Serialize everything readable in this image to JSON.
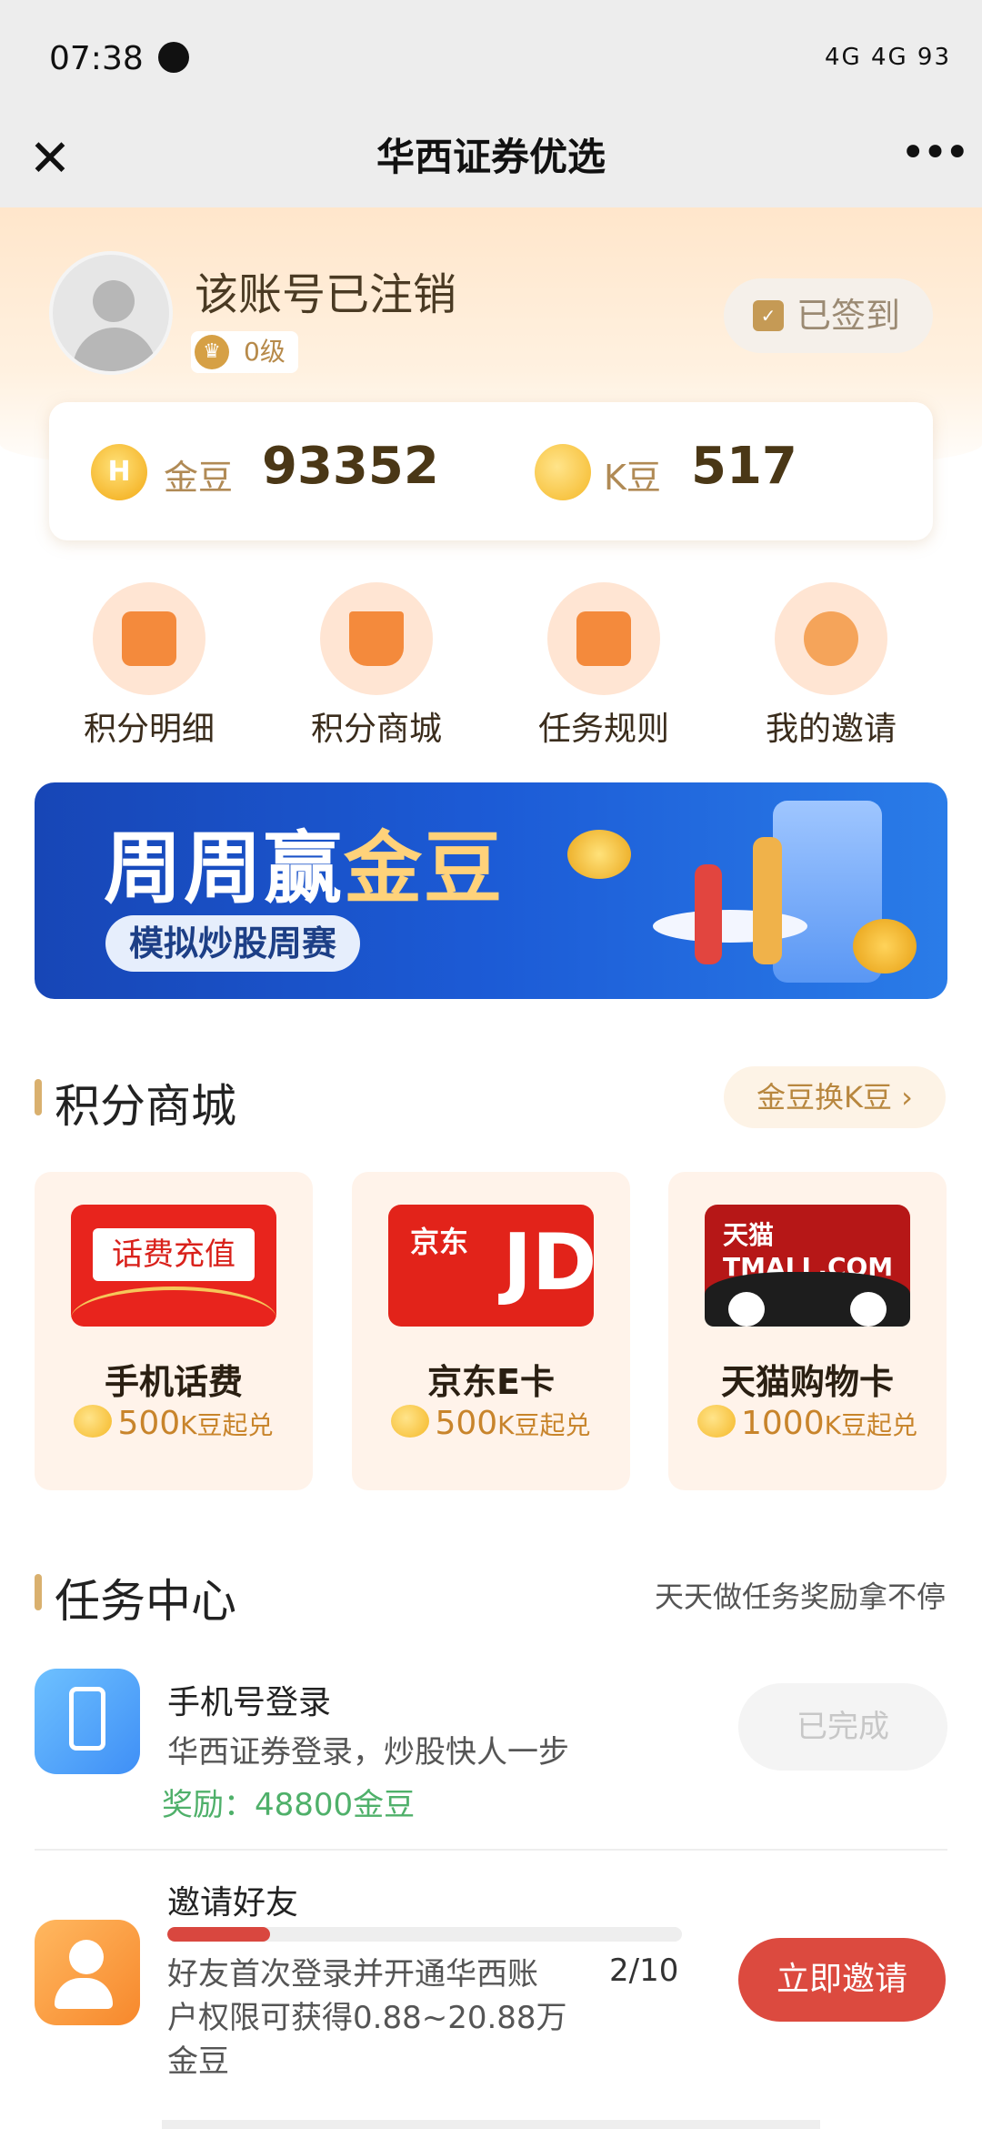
{
  "status_bar": {
    "time": "07:38",
    "indicators": "4G 4G 93"
  },
  "nav": {
    "close_icon": "close-icon",
    "title": "华西证券优选",
    "more_icon": "more-icon"
  },
  "profile": {
    "username": "该账号已注销",
    "level": "0级",
    "signin": "已签到"
  },
  "points": {
    "gold_label": "金豆",
    "gold_value": "93352",
    "k_label": "K豆",
    "k_value": "517"
  },
  "quick_actions": [
    {
      "label": "积分明细",
      "icon": "document-icon"
    },
    {
      "label": "积分商城",
      "icon": "cart-icon"
    },
    {
      "label": "任务规则",
      "icon": "rules-icon"
    },
    {
      "label": "我的邀请",
      "icon": "user-icon"
    }
  ],
  "banner": {
    "title_part1": "周周赢",
    "title_part2": "金豆",
    "subtitle": "模拟炒股周赛"
  },
  "mall": {
    "title": "积分商城",
    "exchange": "金豆换K豆 ›",
    "items": [
      {
        "image_text": "话费充值",
        "name": "手机话费",
        "price": "500",
        "price_unit": "K豆起兑"
      },
      {
        "image_text": "京东",
        "image_text2": "JD",
        "name": "京东E卡",
        "price": "500",
        "price_unit": "K豆起兑"
      },
      {
        "image_text": "天猫 TMALL.COM",
        "name": "天猫购物卡",
        "price": "1000",
        "price_unit": "K豆起兑"
      }
    ]
  },
  "tasks": {
    "title": "任务中心",
    "subtitle": "天天做任务奖励拿不停",
    "items": [
      {
        "name": "手机号登录",
        "desc": "华西证券登录，炒股快人一步",
        "reward": "奖励：48800金豆",
        "button": "已完成"
      },
      {
        "name": "邀请好友",
        "desc": "好友首次登录并开通华西账户权限可获得0.88~20.88万金豆",
        "progress": "2/10",
        "progress_fraction": 0.2,
        "button": "立即邀请"
      }
    ]
  },
  "colors": {
    "accent": "#dc4a3f",
    "gold": "#c8842b",
    "header_bg": "#ffe6cb"
  }
}
